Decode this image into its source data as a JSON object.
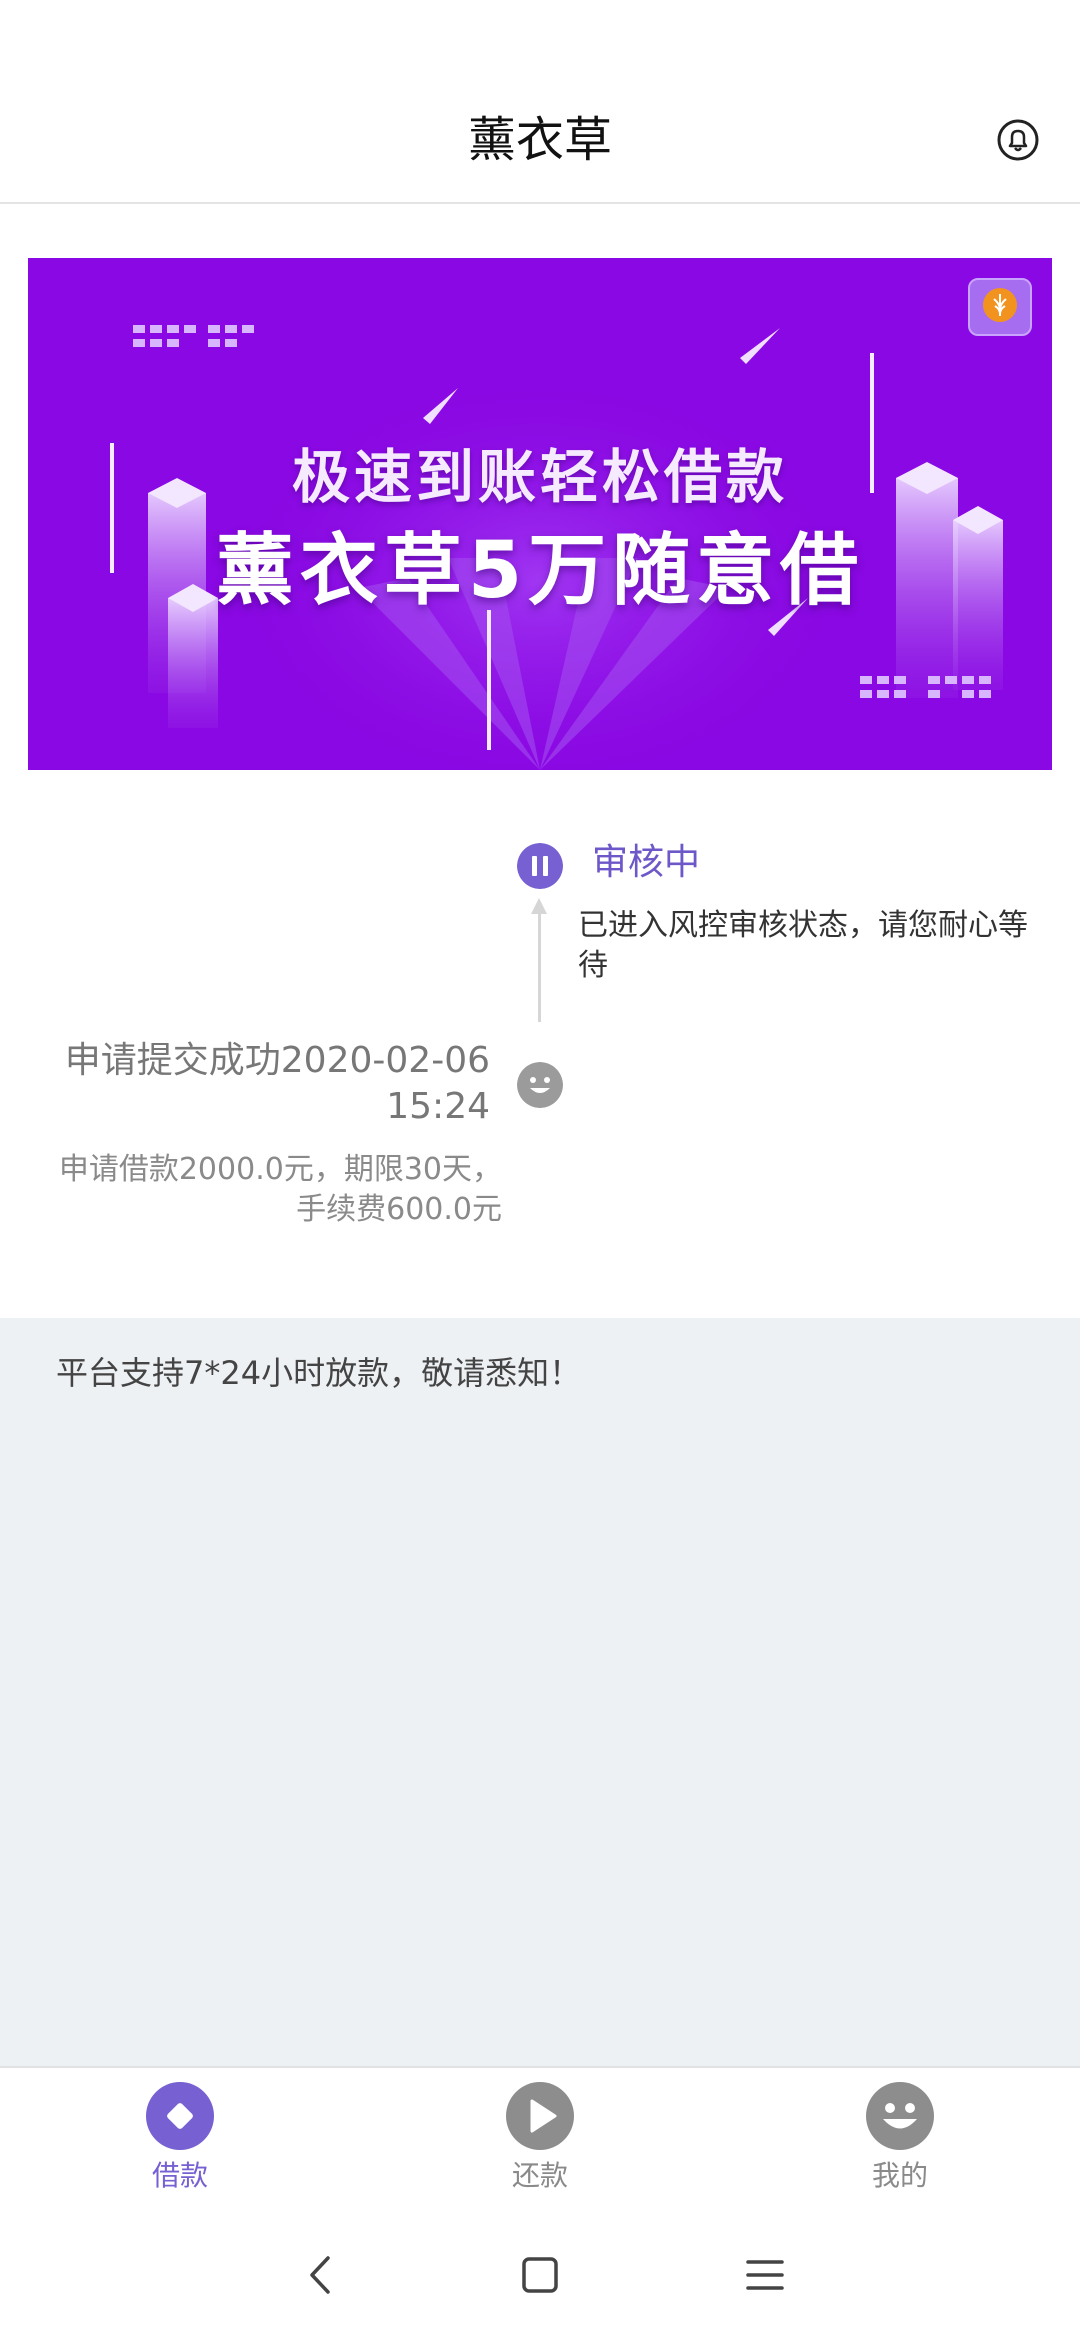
{
  "header": {
    "title": "薰衣草",
    "bell_icon": "bell-icon"
  },
  "banner": {
    "line1": "极速到账轻松借款",
    "line2": "薰衣草5万随意借",
    "colors": {
      "background": "#8a08e3",
      "accent": "#c38bff"
    }
  },
  "timeline": {
    "current": {
      "icon": "pause-icon",
      "status": "审核中",
      "description": "已进入风控审核状态，请您耐心等待"
    },
    "submitted": {
      "icon": "smiley-icon",
      "title": "申请提交成功2020-02-06 15:24",
      "description": "申请借款2000.0元，期限30天，手续费600.0元"
    }
  },
  "notice": {
    "text": "平台支持7*24小时放款，敬请悉知！"
  },
  "tabbar": {
    "items": [
      {
        "label": "借款",
        "icon": "diamond-icon",
        "active": true
      },
      {
        "label": "还款",
        "icon": "play-icon",
        "active": false
      },
      {
        "label": "我的",
        "icon": "smiley-icon",
        "active": false
      }
    ],
    "active_color": "#7760d2",
    "inactive_color": "#8a8a8a"
  },
  "navbar": {
    "items": [
      "back-icon",
      "home-icon",
      "menu-icon"
    ]
  }
}
